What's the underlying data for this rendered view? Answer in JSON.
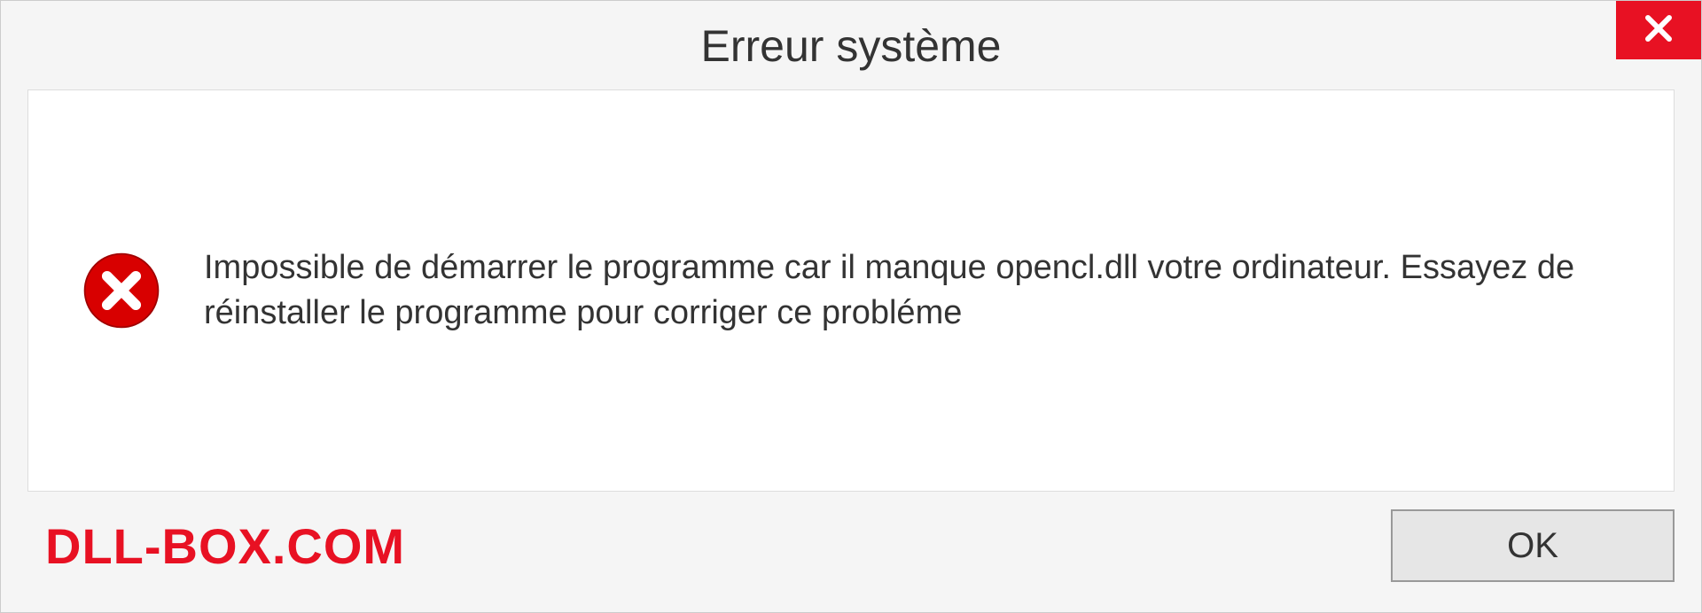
{
  "title": "Erreur système",
  "message": "Impossible de démarrer le programme car il manque opencl.dll votre ordinateur. Essayez de réinstaller le programme pour corriger ce probléme",
  "watermark": "DLL-BOX.COM",
  "ok_label": "OK"
}
